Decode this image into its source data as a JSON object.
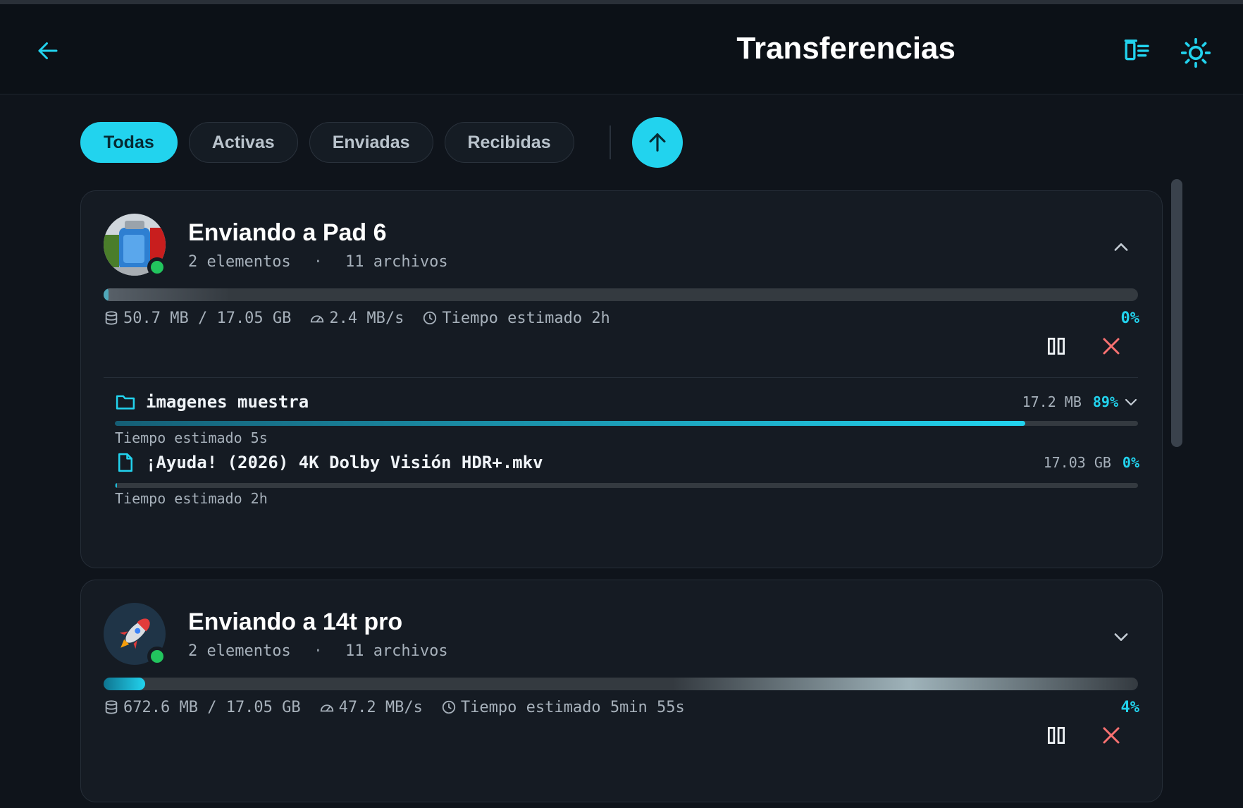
{
  "header": {
    "title": "Transferencias",
    "back_icon": "arrow-left-icon",
    "icons": [
      "transfer-list-icon",
      "sun-icon"
    ]
  },
  "filters": [
    {
      "label": "Todas",
      "active": true
    },
    {
      "label": "Activas",
      "active": false
    },
    {
      "label": "Enviadas",
      "active": false
    },
    {
      "label": "Recibidas",
      "active": false
    }
  ],
  "transfers": [
    {
      "title": "Enviando a Pad 6",
      "elements": "2 elementos",
      "files": "11 archivos",
      "progress": 0.005,
      "size": "50.7 MB / 17.05 GB",
      "speed": "2.4 MB/s",
      "eta": "Tiempo estimado 2h",
      "percent": "0%",
      "expanded": true,
      "items": [
        {
          "type": "folder",
          "name": "imagenes muestra",
          "size": "17.2 MB",
          "percent": "89%",
          "progress": 0.89,
          "eta": "Tiempo estimado 5s"
        },
        {
          "type": "file",
          "name": "¡Ayuda! (2026) 4K Dolby Visión HDR+.mkv",
          "size": "17.03 GB",
          "percent": "0%",
          "progress": 0.002,
          "eta": "Tiempo estimado 2h"
        }
      ]
    },
    {
      "title": "Enviando a 14t pro",
      "elements": "2 elementos",
      "files": "11 archivos",
      "progress": 0.04,
      "size": "672.6 MB / 17.05 GB",
      "speed": "47.2 MB/s",
      "eta": "Tiempo estimado 5min 55s",
      "percent": "4%",
      "expanded": false
    }
  ],
  "colors": {
    "accent": "#22d3ee",
    "online": "#22c55e",
    "cancel": "#f87171",
    "background": "#0f141b"
  }
}
